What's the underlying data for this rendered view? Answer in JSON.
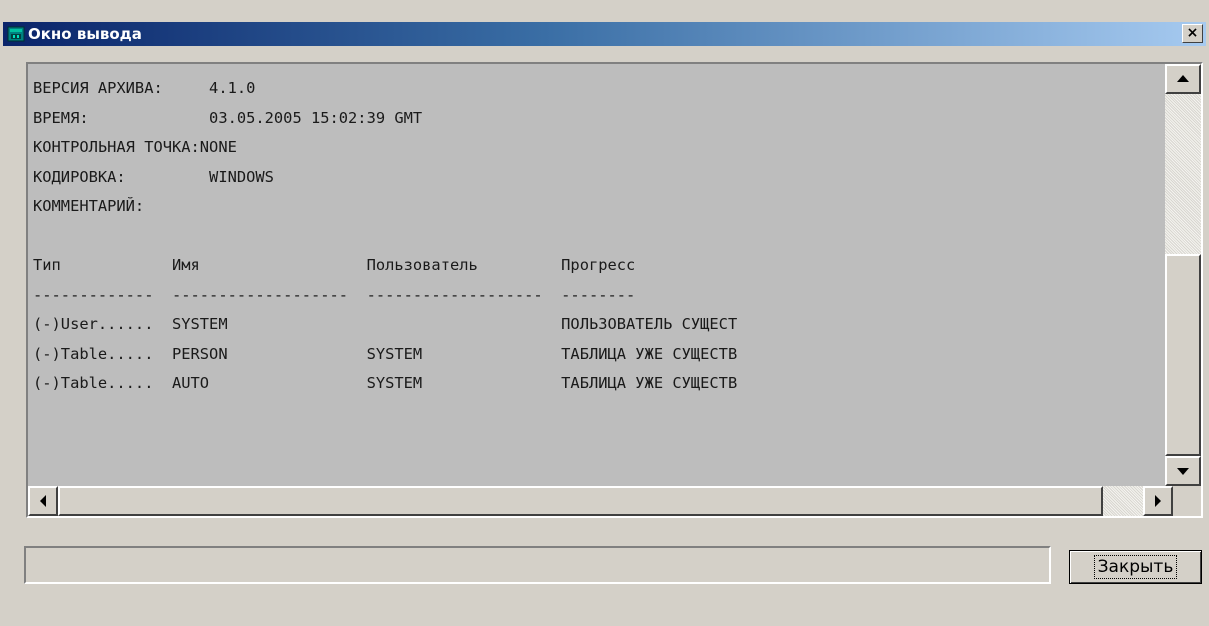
{
  "window": {
    "title": "Окно вывода",
    "close_glyph": "×"
  },
  "output": {
    "lines": [
      "ВЕРСИЯ АРХИВА:     4.1.0",
      "ВРЕМЯ:             03.05.2005 15:02:39 GMT",
      "КОНТРОЛЬНАЯ ТОЧКА:NONE",
      "КОДИРОВКА:         WINDOWS",
      "КОММЕНТАРИЙ:",
      "",
      "Тип            Имя                  Пользователь         Прогресс",
      "-------------  -------------------  -------------------  --------",
      "(-)User......  SYSTEM                                    ПОЛЬЗОВАТЕЛЬ СУЩЕСТ",
      "(-)Table.....  PERSON               SYSTEM               ТАБЛИЦА УЖЕ СУЩЕСТВ",
      "(-)Table.....  AUTO                 SYSTEM               ТАБЛИЦА УЖЕ СУЩЕСТВ"
    ],
    "text": ""
  },
  "status": {
    "text": ""
  },
  "buttons": {
    "close_label": "Закрыть"
  },
  "icons": {
    "window": "output-window-icon",
    "scroll_up": "arrow-up-icon",
    "scroll_down": "arrow-down-icon",
    "scroll_left": "arrow-left-icon",
    "scroll_right": "arrow-right-icon"
  },
  "scroll": {
    "vertical_position": 0.85,
    "horizontal_position": 0.0
  },
  "colors": {
    "titlebar_start": "#0a246a",
    "titlebar_end": "#a6caf0",
    "output_background": "#bdbdbd",
    "window_background": "#d4d0c8"
  }
}
